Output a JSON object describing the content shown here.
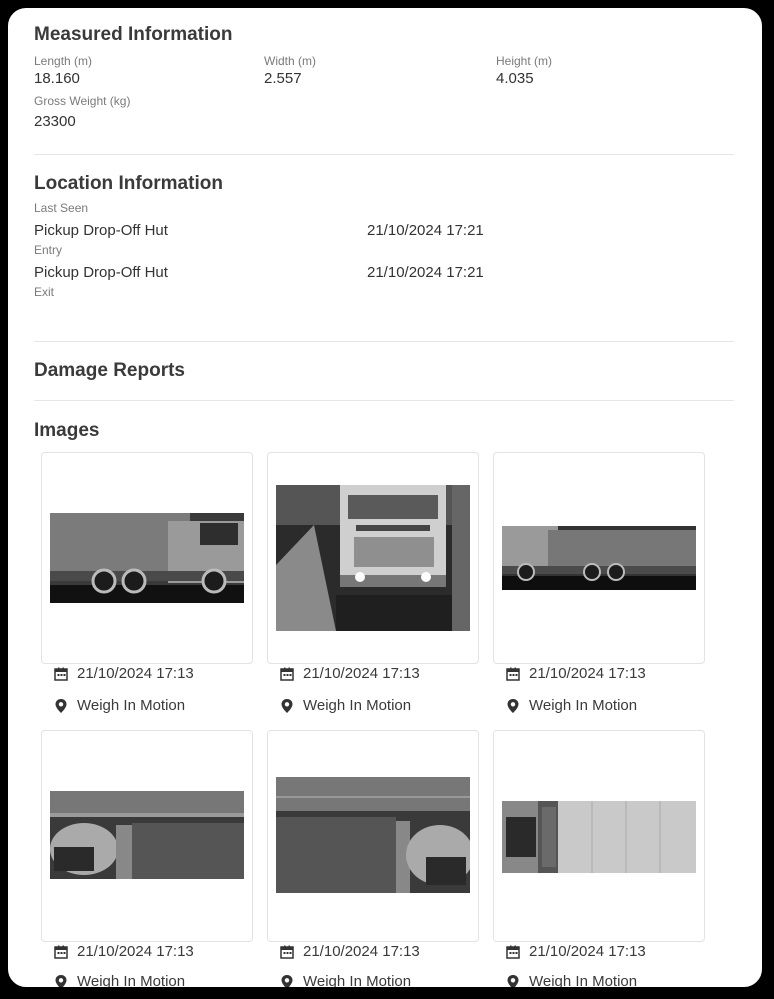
{
  "measured": {
    "title": "Measured Information",
    "length_label": "Length (m)",
    "length_value": "18.160",
    "width_label": "Width (m)",
    "width_value": "2.557",
    "height_label": "Height (m)",
    "height_value": "4.035",
    "gross_label": "Gross Weight (kg)",
    "gross_value": "23300"
  },
  "location": {
    "title": "Location Information",
    "last_seen_label": "Last Seen",
    "last_seen_place": "Pickup Drop-Off Hut",
    "last_seen_time": "21/10/2024 17:21",
    "entry_label": "Entry",
    "entry_place": "Pickup Drop-Off Hut",
    "entry_time": "21/10/2024 17:21",
    "exit_label": "Exit"
  },
  "damage": {
    "title": "Damage Reports"
  },
  "images": {
    "title": "Images",
    "items": [
      {
        "timestamp": "21/10/2024 17:13",
        "location": "Weigh In Motion",
        "view": "side-view-truck-photo"
      },
      {
        "timestamp": "21/10/2024 17:13",
        "location": "Weigh In Motion",
        "view": "front-view-truck-photo"
      },
      {
        "timestamp": "21/10/2024 17:13",
        "location": "Weigh In Motion",
        "view": "side-view-truck-photo"
      },
      {
        "timestamp": "21/10/2024 17:13",
        "location": "Weigh In Motion",
        "view": "overhead-cab-photo"
      },
      {
        "timestamp": "21/10/2024 17:13",
        "location": "Weigh In Motion",
        "view": "overhead-cab-photo"
      },
      {
        "timestamp": "21/10/2024 17:13",
        "location": "Weigh In Motion",
        "view": "overhead-trailer-photo"
      }
    ]
  },
  "icons": {
    "date": "calendar-icon",
    "place": "map-pin-icon"
  }
}
